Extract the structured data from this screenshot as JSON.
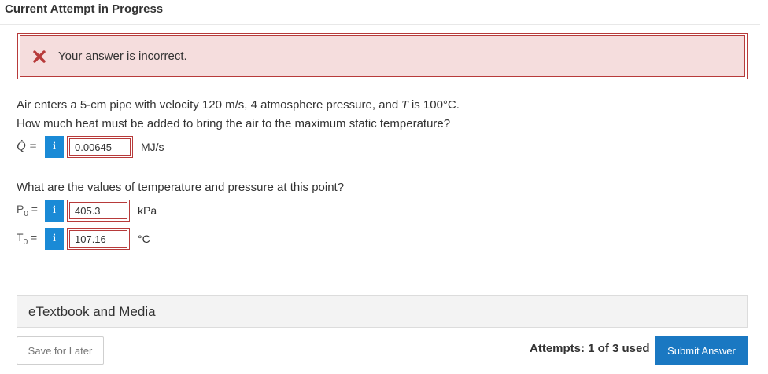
{
  "header": {
    "title": "Current Attempt in Progress"
  },
  "alert": {
    "message": "Your answer is incorrect.",
    "icon": "close-icon",
    "color": "#b73a3a"
  },
  "question": {
    "line1_pre": "Air enters a 5-cm pipe with velocity 120 m/s, 4 atmosphere pressure, and ",
    "line1_var": "T",
    "line1_post": " is 100°C.",
    "line2": "How much heat must be added to bring the air to the maximum static temperature?",
    "q_symbol": "Q̇ =",
    "q_value": "0.00645",
    "q_unit": "MJ/s",
    "line3": "What are the values of temperature and pressure at this point?",
    "p_symbol": "P",
    "p_sub": "0",
    "p_eq": " =",
    "p_value": "405.3",
    "p_unit": "kPa",
    "t_symbol": "T",
    "t_sub": "0",
    "t_eq": " =",
    "t_value": "107.16",
    "t_unit": "°C",
    "info_label": "i"
  },
  "etextbook": {
    "label": "eTextbook and Media"
  },
  "footer": {
    "save_label": "Save for Later",
    "attempts_label": "Attempts: 1 of 3 used",
    "submit_label": "Submit Answer"
  },
  "colors": {
    "accent": "#1a78c2",
    "info": "#1a8ad6",
    "error_bg": "#f5dddd"
  }
}
